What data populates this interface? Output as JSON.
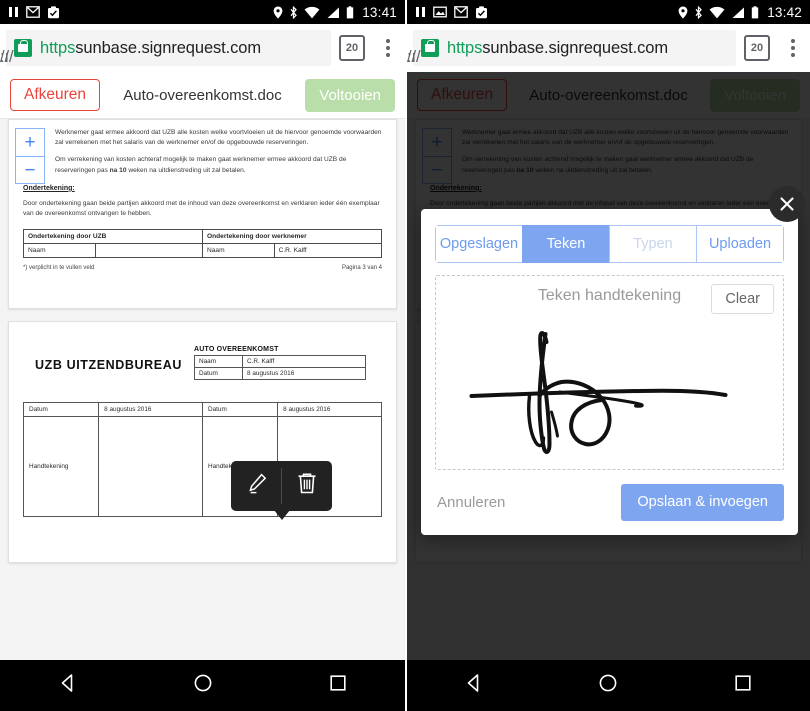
{
  "left": {
    "status_bar": {
      "icons": [
        "pause-icon",
        "gmail-icon",
        "clipboard-check-icon"
      ],
      "right_icons": [
        "location-icon",
        "bluetooth-icon",
        "wifi-icon",
        "signal-icon",
        "battery-icon"
      ],
      "time": "13:41"
    },
    "browser": {
      "url_scheme": "https",
      "url_sep": "://",
      "url_host": "sunbase.signrequest.com",
      "url_path": "/ı",
      "tab_count": "20",
      "lock_icon": "lock-icon",
      "menu_icon": "kebab-menu-icon"
    },
    "app_header": {
      "reject_label": "Afkeuren",
      "doc_title": "Auto-overeenkomst.doc",
      "complete_label": "Voltooien"
    },
    "zoom_controls": {
      "zoom_in": "+",
      "zoom_out": "−"
    },
    "page1": {
      "para1": "Werknemer gaat ermee akkoord dat UZB alle kosten welke voortvloeien uit de hiervoor genoemde voorwaarden zal verrekenen met het salaris van de werknemer en/of de opgebouwde reserveringen.",
      "para2_a": "Om verrekening van kosten achteraf mogelijk te maken gaat werknemer ermee akkoord dat UZB de reserveringen pas ",
      "para2_b": "na 10",
      "para2_c": " weken na uitdienstreding uit zal betalen.",
      "section_heading": "Ondertekening:",
      "para3": "Door ondertekening gaan beide partijen akkoord met de inhoud van deze overeenkomst en verklaren ieder één exemplaar van de overeenkomst ontvangen te hebben.",
      "table": {
        "header_left": "Ondertekening door UZB",
        "header_right": "Ondertekening door werknemer",
        "row_label_left": "Naam",
        "row_value_left": "",
        "row_label_right": "Naam",
        "row_value_right": "C.R.  Kalff"
      },
      "footer_left": "*) verplicht in te vullen veld",
      "footer_right": "Pagina 3 van 4"
    },
    "page2": {
      "brand": "UZB UITZENDBUREAU",
      "doc_kind": "AUTO OVEREENKOMST",
      "mini_rows": [
        {
          "label": "Naam",
          "value": "C.R.  Kalff"
        },
        {
          "label": "Datum",
          "value": "8 augustus 2016"
        }
      ],
      "big_table": {
        "r1": [
          "Datum",
          "8 augustus 2016",
          "Datum",
          "8 augustus 2016"
        ],
        "r2": [
          "Handtekening",
          "",
          "Handtekening",
          ""
        ]
      }
    },
    "tooltip": {
      "edit_icon": "pencil-icon",
      "delete_icon": "trash-icon"
    }
  },
  "right": {
    "status_bar": {
      "icons": [
        "pause-icon",
        "screenshot-icon",
        "gmail-icon",
        "clipboard-check-icon"
      ],
      "time": "13:42"
    },
    "modal": {
      "close_icon": "close-icon",
      "tabs": [
        {
          "label": "Opgeslagen",
          "state": "normal"
        },
        {
          "label": "Teken",
          "state": "active"
        },
        {
          "label": "Typen",
          "state": "disabled"
        },
        {
          "label": "Uploaden",
          "state": "normal"
        }
      ],
      "canvas_hint": "Teken handtekening",
      "clear_label": "Clear",
      "cancel_label": "Annuleren",
      "save_label": "Opslaan & invoegen",
      "signature_alt": "handwritten-signature"
    }
  },
  "nav_bar": {
    "back": "back-icon",
    "home": "home-icon",
    "recents": "recents-icon"
  },
  "colors": {
    "accent_blue": "#7ea6f0",
    "reject_red": "#e8453c",
    "complete_green": "#b9deaa",
    "lock_green": "#0f9d58",
    "overlay": "rgba(0,0,0,0.80)"
  }
}
